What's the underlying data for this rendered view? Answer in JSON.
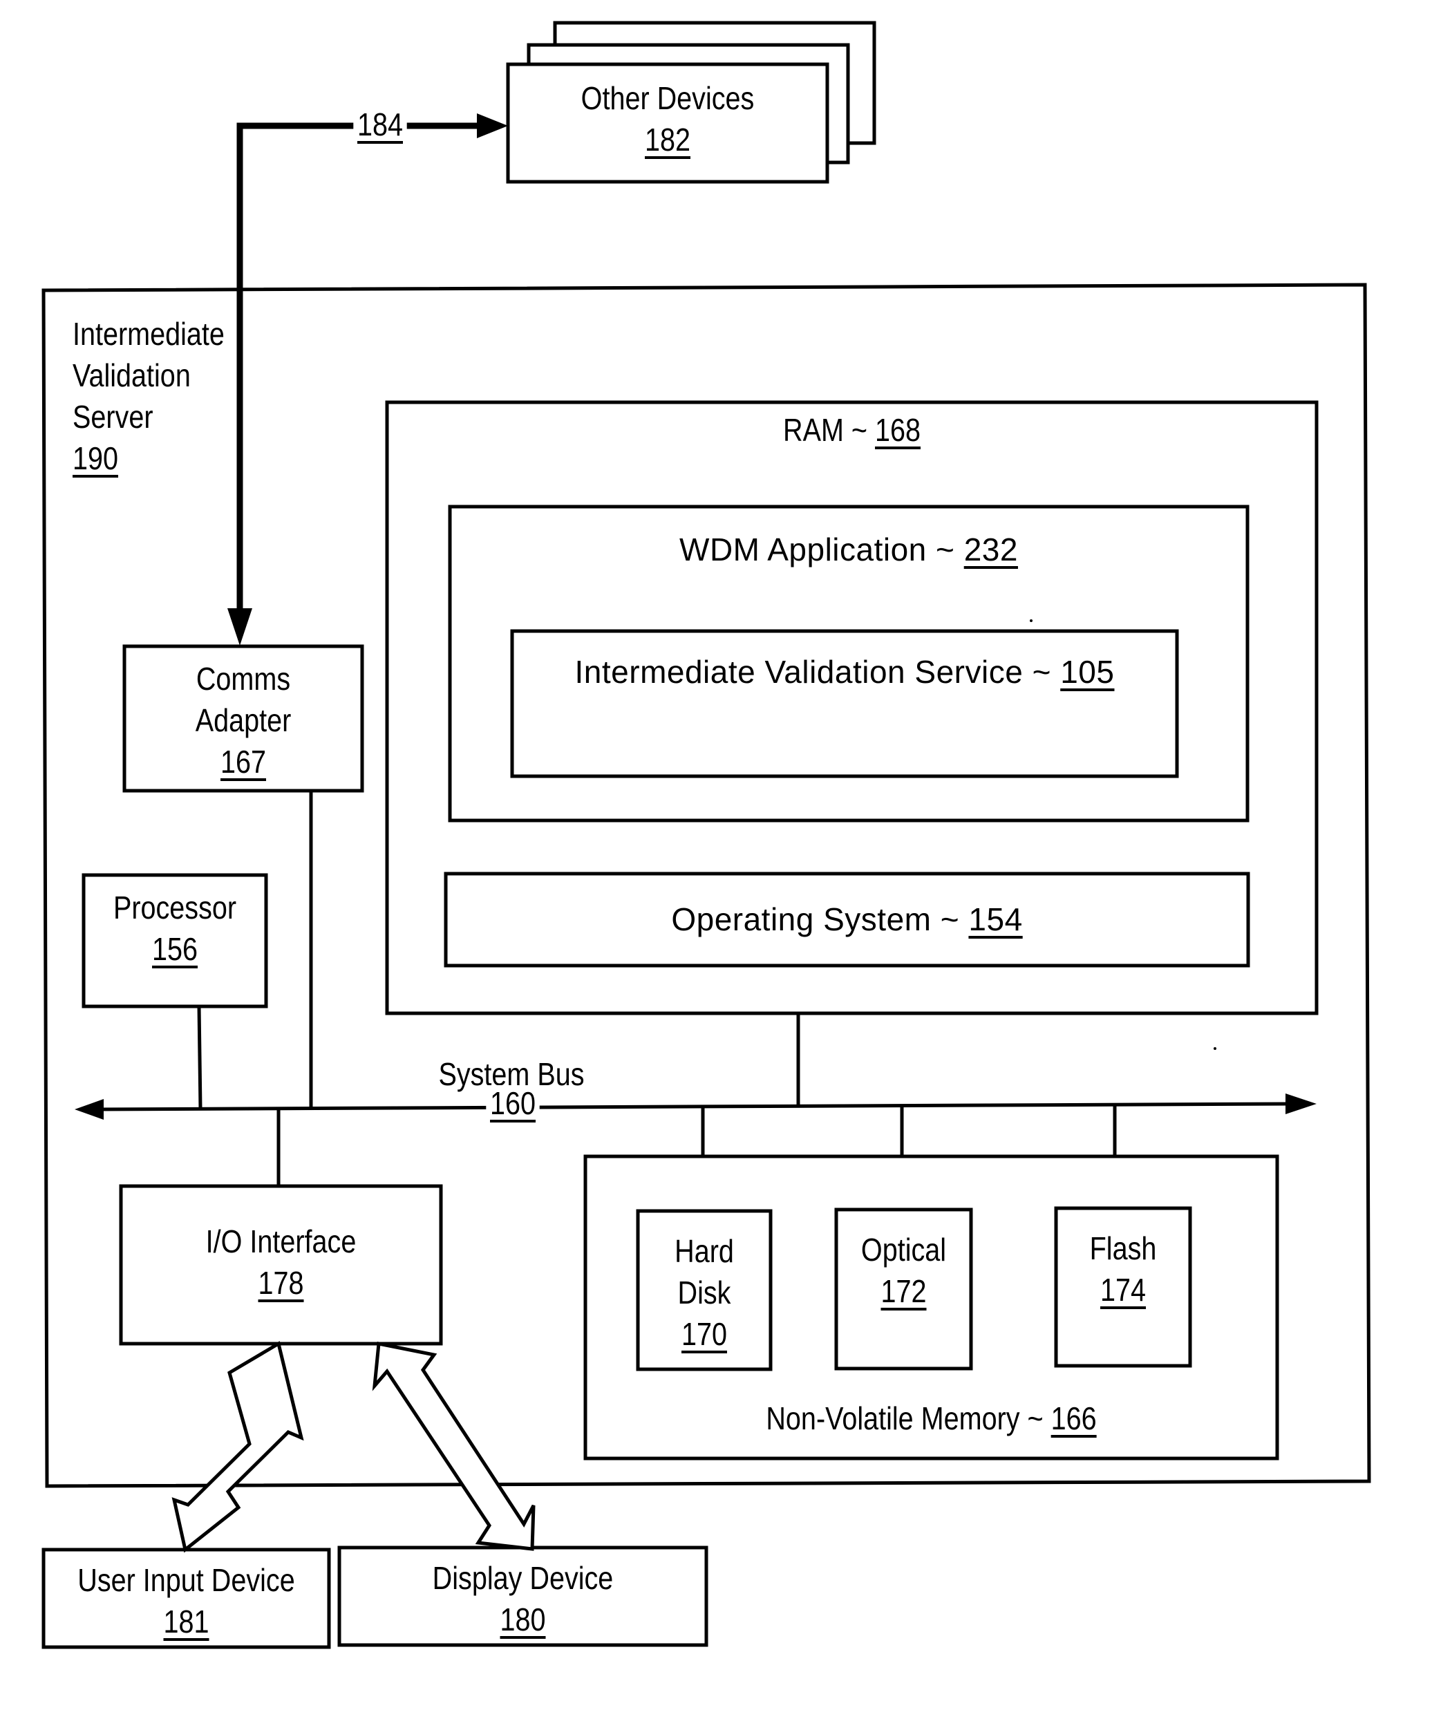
{
  "figure": {
    "other_devices": {
      "label": "Other Devices",
      "ref": "182"
    },
    "link": {
      "ref": "184"
    },
    "server": {
      "line1": "Intermediate",
      "line2": "Validation",
      "line3": "Server",
      "ref": "190"
    },
    "ram": {
      "label": "RAM ~ ",
      "ref": "168"
    },
    "wdm_application": {
      "label": "WDM Application ~ ",
      "ref": "232"
    },
    "validation_service": {
      "label": "Intermediate Validation Service  ~ ",
      "ref": "105"
    },
    "operating_system": {
      "label": "Operating System ~ ",
      "ref": "154"
    },
    "comms_adapter": {
      "line1": "Comms",
      "line2": "Adapter",
      "ref": "167"
    },
    "processor": {
      "label": "Processor",
      "ref": "156"
    },
    "system_bus": {
      "label": "System Bus",
      "ref": "160"
    },
    "io_interface": {
      "label": "I/O Interface",
      "ref": "178"
    },
    "non_volatile_memory": {
      "label": "Non-Volatile Memory ~ ",
      "ref": "166"
    },
    "hard_disk": {
      "line1": "Hard",
      "line2": "Disk",
      "ref": "170"
    },
    "optical": {
      "label": "Optical",
      "ref": "172"
    },
    "flash": {
      "label": "Flash",
      "ref": "174"
    },
    "user_input_device": {
      "label": "User Input Device",
      "ref": "181"
    },
    "display_device": {
      "label": "Display Device",
      "ref": "180"
    }
  }
}
